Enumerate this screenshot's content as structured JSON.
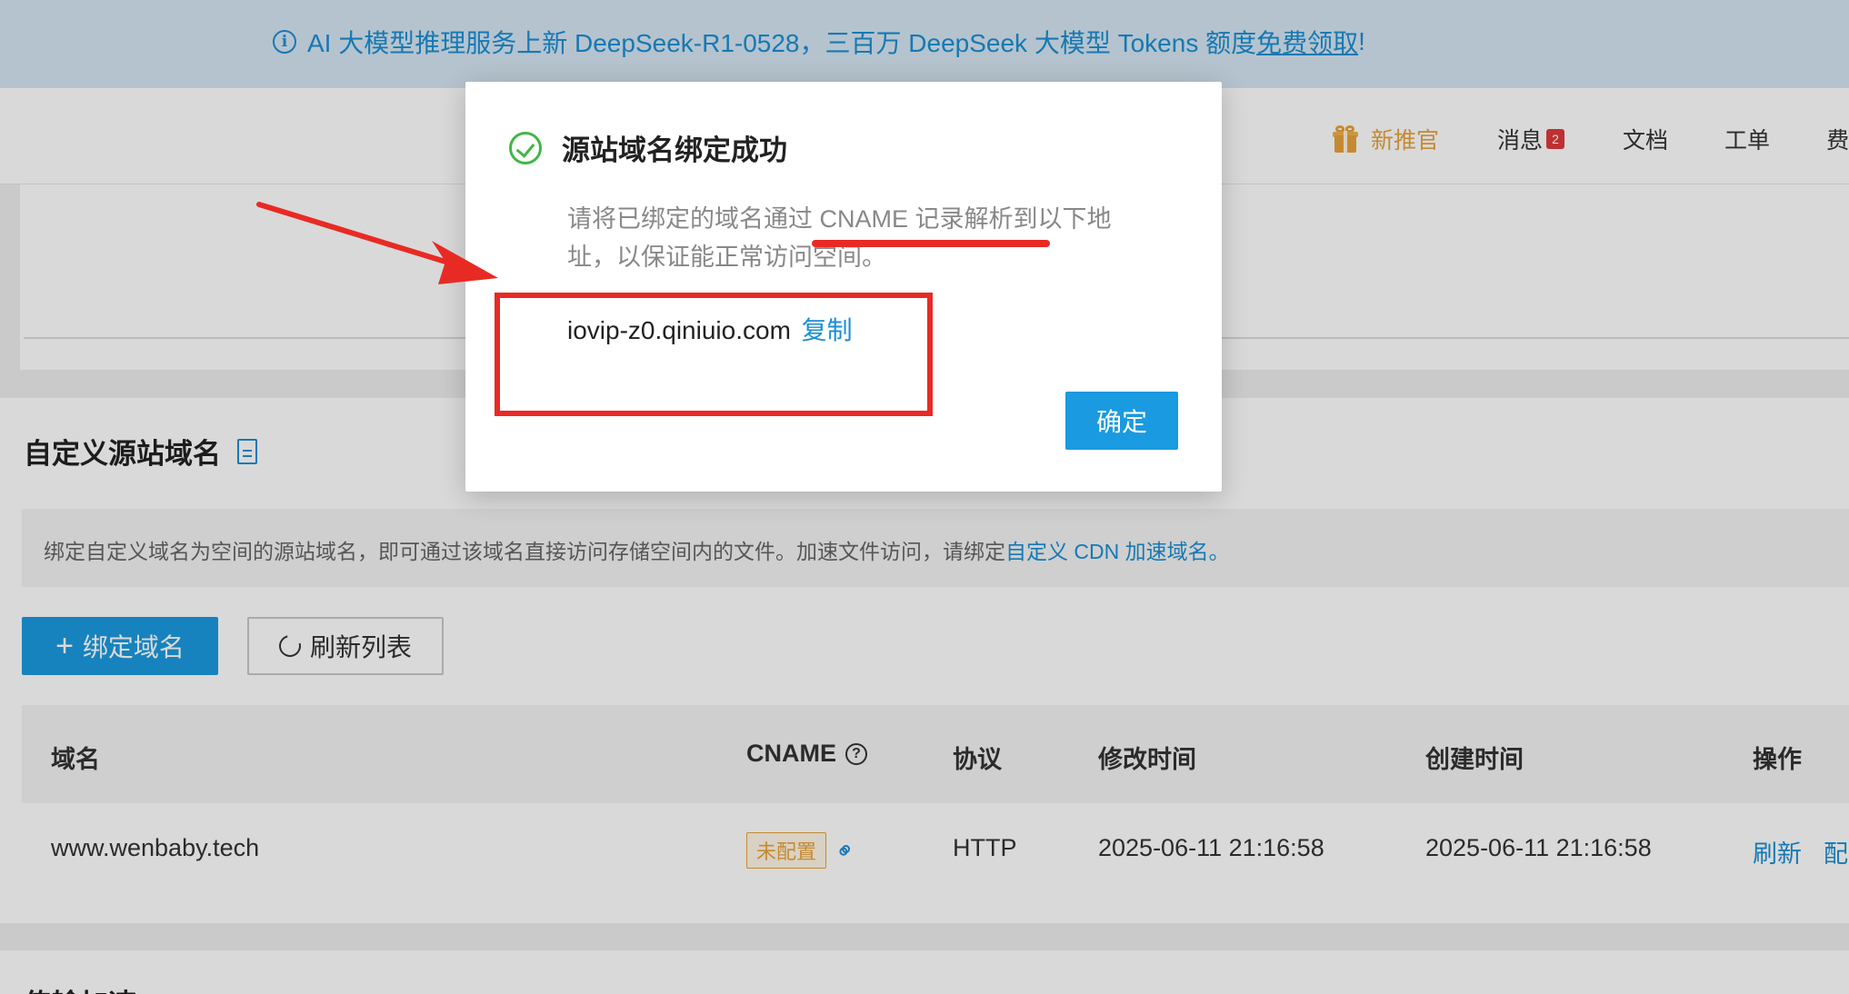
{
  "banner": {
    "text": "AI 大模型推理服务上新 DeepSeek-R1-0528，三百万 DeepSeek 大模型 Tokens 额度",
    "link": "免费领取",
    "suffix": "!"
  },
  "header": {
    "nav": {
      "promo": "新推官",
      "messages": "消息",
      "messages_count": "2",
      "docs": "文档",
      "tickets": "工单",
      "billing": "费"
    }
  },
  "section": {
    "title": "自定义源站域名",
    "notice": "绑定自定义域名为空间的源站域名，即可通过该域名直接访问存储空间内的文件。加速文件访问，请绑定",
    "notice_link": "自定义 CDN 加速域名。",
    "bind_button": "绑定域名",
    "refresh_button": "刷新列表"
  },
  "table": {
    "columns": [
      "域名",
      "CNAME",
      "协议",
      "修改时间",
      "创建时间",
      "操作"
    ],
    "rows": [
      {
        "domain": "www.wenbaby.tech",
        "cname_status": "未配置",
        "protocol": "HTTP",
        "modified": "2025-06-11 21:16:58",
        "created": "2025-06-11 21:16:58",
        "action_refresh": "刷新",
        "action_config": "配"
      }
    ]
  },
  "bottom_section": {
    "title": "传输加速"
  },
  "modal": {
    "title": "源站域名绑定成功",
    "message": "请将已绑定的域名通过 CNAME 记录解析到以下地址，以保证能正常访问空间。",
    "cname": "iovip-z0.qiniuio.com",
    "copy": "复制",
    "confirm": "确定"
  },
  "colors": {
    "accent": "#1a9ae0",
    "success": "#3fb744",
    "warning": "#e8a33a",
    "annotation": "#e82a24"
  }
}
